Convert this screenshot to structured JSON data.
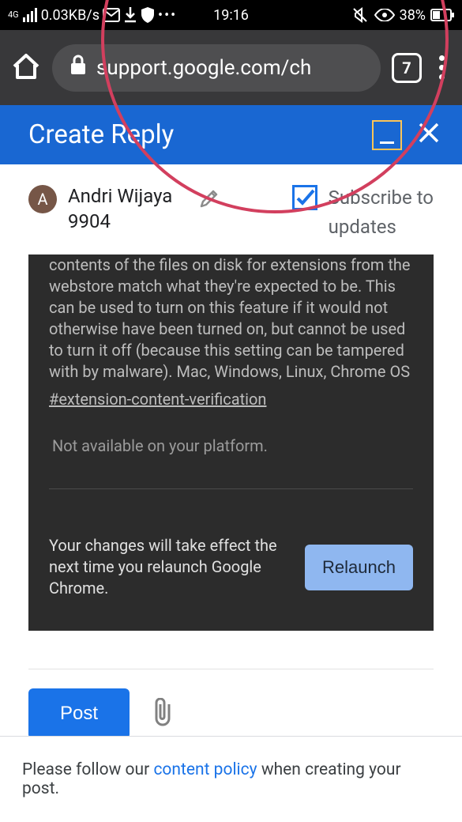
{
  "status": {
    "network_badge": "4G",
    "speed": "0.03KB/s",
    "time": "19:16",
    "battery": "38%"
  },
  "browser": {
    "url_text": "support.google.com/ch",
    "tab_count": "7"
  },
  "reply_header": {
    "title": "Create Reply"
  },
  "author": {
    "initial": "A",
    "name_line1": "Andri Wijaya",
    "name_line2": "9904"
  },
  "subscribe": {
    "line1": "Subscribe to",
    "line2": "updates"
  },
  "flags": {
    "desc": "contents of the files on disk for extensions from the webstore match what they're expected to be. This can be used to turn on this feature if it would not otherwise have been turned on, but cannot be used to turn it off (because this setting can be tampered with by malware). Mac, Windows, Linux, Chrome OS",
    "flag_name": "#extension-content-verification",
    "not_available": "Not available on your platform.",
    "relaunch_msg": "Your changes will take effect the next time you relaunch Google Chrome.",
    "relaunch_btn": "Relaunch"
  },
  "actions": {
    "post": "Post"
  },
  "policy": {
    "prefix": "Please follow our ",
    "link": "content policy",
    "suffix": " when creating your post."
  }
}
